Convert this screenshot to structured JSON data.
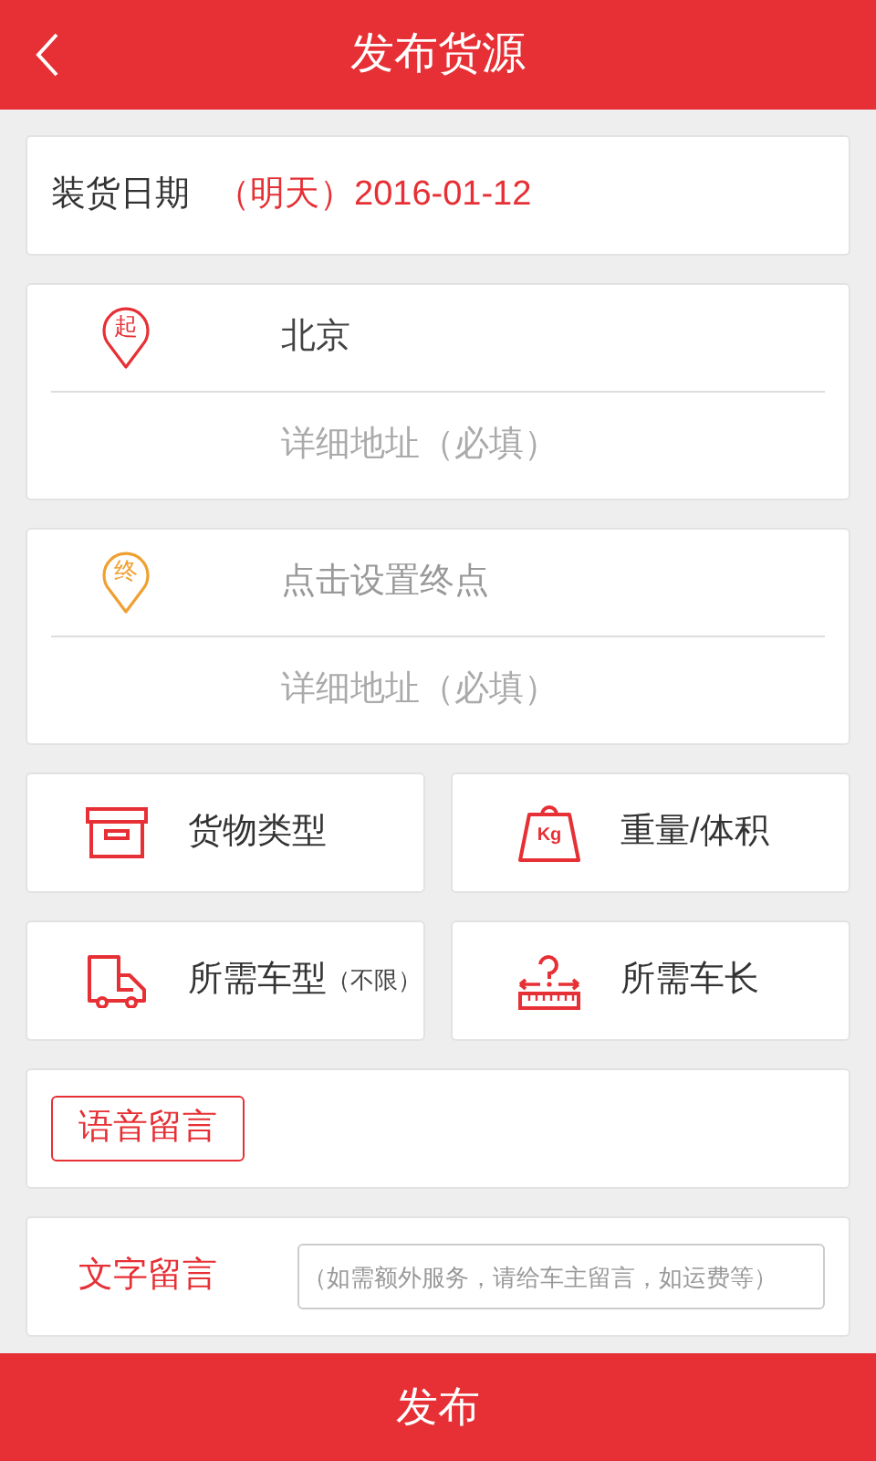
{
  "header": {
    "title": "发布货源"
  },
  "loading_date": {
    "label": "装货日期",
    "value": "（明天）2016-01-12"
  },
  "route": [
    {
      "kind": "start",
      "pin": "起",
      "color": "#e63035",
      "city": "北京",
      "detail_placeholder": "详细地址（必填）"
    },
    {
      "kind": "end",
      "pin": "终",
      "color": "#f0a030",
      "city_placeholder": "点击设置终点",
      "detail_placeholder": "详细地址（必填）"
    }
  ],
  "options": [
    {
      "kind": "box",
      "label": "货物类型"
    },
    {
      "kind": "weight",
      "label": "重量/体积",
      "icon_text": "Kg"
    },
    {
      "kind": "truck",
      "label": "所需车型",
      "note": "（不限）"
    },
    {
      "kind": "ruler",
      "label": "所需车长"
    }
  ],
  "voice_message": {
    "button": "语音留言"
  },
  "text_message": {
    "label": "文字留言",
    "placeholder": "（如需额外服务，请给车主留言，如运费等）"
  },
  "submit": {
    "label": "发布"
  }
}
